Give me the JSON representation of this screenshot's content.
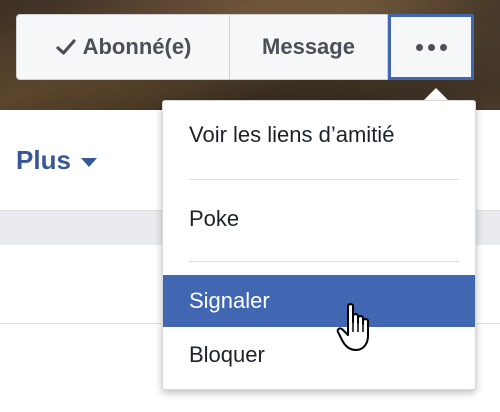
{
  "profile_actions": {
    "follow_label": "Abonné(e)",
    "message_label": "Message"
  },
  "tabs": {
    "more_label": "Plus"
  },
  "dropdown": {
    "items": [
      {
        "label": "Voir les liens d’amitié"
      },
      {
        "label": "Poke"
      },
      {
        "label": "Signaler",
        "highlighted": true
      },
      {
        "label": "Bloquer"
      }
    ]
  },
  "icons": {
    "follow": "checkmark-icon",
    "more": "ellipsis-icon",
    "plus_caret": "caret-down-icon",
    "cursor": "hand-pointer-icon"
  },
  "colors": {
    "accent": "#4267b2",
    "link": "#365899"
  }
}
